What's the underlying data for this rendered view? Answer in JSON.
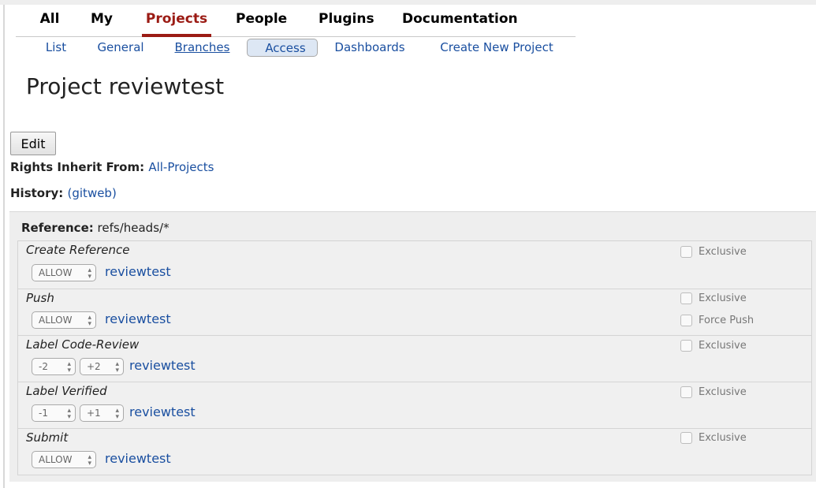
{
  "top_menu": {
    "items": [
      "All",
      "My",
      "Projects",
      "People",
      "Plugins",
      "Documentation"
    ],
    "active": "Projects"
  },
  "sub_menu": {
    "items": [
      "List",
      "General",
      "Branches",
      "Access",
      "Dashboards",
      "Create New Project"
    ],
    "selected": "Access"
  },
  "page_title": "Project reviewtest",
  "edit_button": "Edit",
  "rights_inherit": {
    "label": "Rights Inherit From:",
    "value": "All-Projects"
  },
  "history": {
    "label": "History:",
    "value": "(gitweb)"
  },
  "reference": {
    "label": "Reference:",
    "value": "refs/heads/*",
    "permissions": [
      {
        "name": "Create Reference",
        "values": [
          "ALLOW"
        ],
        "group": "reviewtest",
        "options": [
          "Exclusive"
        ]
      },
      {
        "name": "Push",
        "values": [
          "ALLOW"
        ],
        "group": "reviewtest",
        "options": [
          "Exclusive",
          "Force Push"
        ]
      },
      {
        "name": "Label Code-Review",
        "values": [
          "-2",
          "+2"
        ],
        "group": "reviewtest",
        "options": [
          "Exclusive"
        ]
      },
      {
        "name": "Label Verified",
        "values": [
          "-1",
          "+1"
        ],
        "group": "reviewtest",
        "options": [
          "Exclusive"
        ]
      },
      {
        "name": "Submit",
        "values": [
          "ALLOW"
        ],
        "group": "reviewtest",
        "options": [
          "Exclusive"
        ]
      }
    ]
  },
  "colors": {
    "active_tab": "#9b1b14",
    "link": "#1a4fa0",
    "selected_subtab_bg": "#dde7f4",
    "panel_bg": "#eeeeee"
  },
  "icons": {
    "select_arrow": "updown-arrow-icon",
    "checkbox": "checkbox-icon"
  }
}
